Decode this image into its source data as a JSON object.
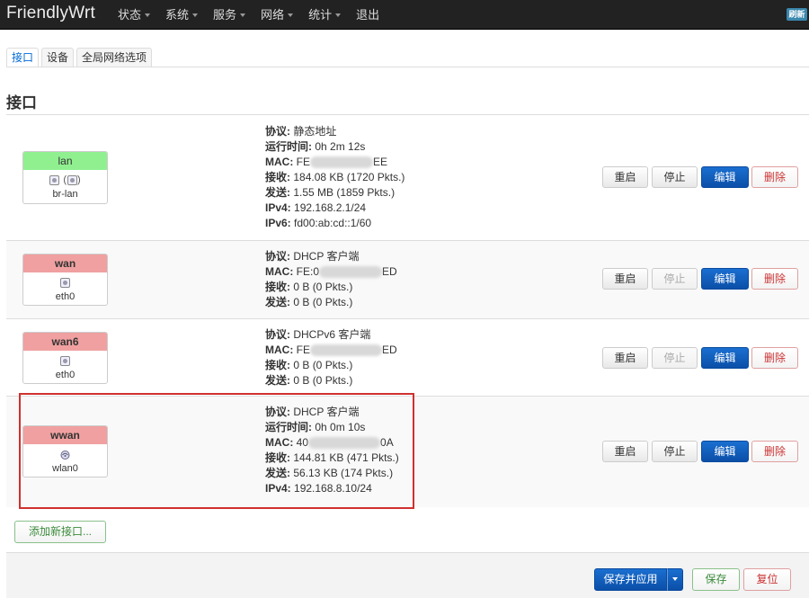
{
  "brand": "FriendlyWrt",
  "menu": [
    {
      "label": "状态",
      "has_caret": true
    },
    {
      "label": "系统",
      "has_caret": true
    },
    {
      "label": "服务",
      "has_caret": true
    },
    {
      "label": "网络",
      "has_caret": true
    },
    {
      "label": "统计",
      "has_caret": true
    },
    {
      "label": "退出",
      "has_caret": false
    }
  ],
  "refresh_badge": "刷新",
  "tabs": [
    "接口",
    "设备",
    "全局网络选项"
  ],
  "active_tab": "接口",
  "section_title": "接口",
  "interfaces": [
    {
      "name": "lan",
      "status_color": "green",
      "icons": "(   )",
      "device": "br-lan",
      "protocol_label": "协议:",
      "protocol": "静态地址",
      "uptime_label": "运行时间:",
      "uptime": "0h 2m 12s",
      "mac_label": "MAC:",
      "mac_prefix": "FE",
      "mac_suffix": "EE",
      "rx_label": "接收:",
      "rx": "184.08 KB (1720 Pkts.)",
      "tx_label": "发送:",
      "tx": "1.55 MB (1859 Pkts.)",
      "ipv4_label": "IPv4:",
      "ipv4": "192.168.2.1/24",
      "ipv6_label": "IPv6:",
      "ipv6": "fd00:ab:cd::1/60"
    },
    {
      "name": "wan",
      "status_color": "red",
      "device": "eth0",
      "protocol_label": "协议:",
      "protocol": "DHCP 客户端",
      "mac_label": "MAC:",
      "mac_prefix": "FE:0",
      "mac_suffix": "ED",
      "rx_label": "接收:",
      "rx": "0 B (0 Pkts.)",
      "tx_label": "发送:",
      "tx": "0 B (0 Pkts.)"
    },
    {
      "name": "wan6",
      "status_color": "red",
      "device": "eth0",
      "protocol_label": "协议:",
      "protocol": "DHCPv6 客户端",
      "mac_label": "MAC:",
      "mac_prefix": "FE",
      "mac_suffix": "ED",
      "rx_label": "接收:",
      "rx": "0 B (0 Pkts.)",
      "tx_label": "发送:",
      "tx": "0 B (0 Pkts.)"
    },
    {
      "name": "wwan",
      "status_color": "red",
      "device": "wlan0",
      "protocol_label": "协议:",
      "protocol": "DHCP 客户端",
      "uptime_label": "运行时间:",
      "uptime": "0h 0m 10s",
      "mac_label": "MAC:",
      "mac_prefix": "40",
      "mac_suffix": "0A",
      "rx_label": "接收:",
      "rx": "144.81 KB (471 Pkts.)",
      "tx_label": "发送:",
      "tx": "56.13 KB (174 Pkts.)",
      "ipv4_label": "IPv4:",
      "ipv4": "192.168.8.10/24"
    }
  ],
  "row_buttons": {
    "restart": "重启",
    "stop": "停止",
    "edit": "编辑",
    "delete": "删除"
  },
  "add_interface_button": "添加新接口...",
  "footer_buttons": {
    "save_apply": "保存并应用",
    "save": "保存",
    "reset": "复位"
  },
  "colors": {
    "navbar": "#222222",
    "status_up": "#90f090",
    "status_down": "#f0a0a0",
    "primary": "#0b4fa8",
    "highlight": "#d03030"
  }
}
